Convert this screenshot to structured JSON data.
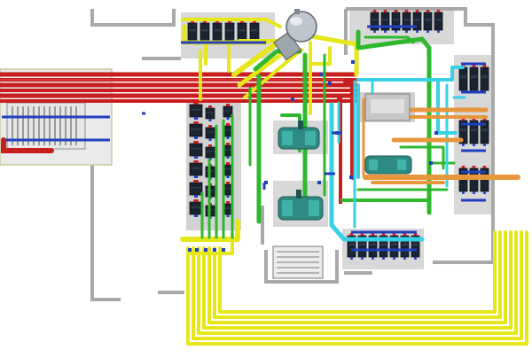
{
  "diagram": {
    "kind": "3d-piping-layout",
    "pipe_colors": {
      "steam": "#c81e1e",
      "water_supply": "#e6e619",
      "return": "#2eb82e",
      "cooling": "#3ad0e6",
      "condensate": "#e8963c",
      "structure": "#a9a9a9",
      "equipment": "#2e8b83",
      "vessel": "#bfc5cc",
      "pump_dark": "#1a2330",
      "manifold": "#1f3fbf",
      "floor": "#ffffff"
    },
    "legend": []
  }
}
